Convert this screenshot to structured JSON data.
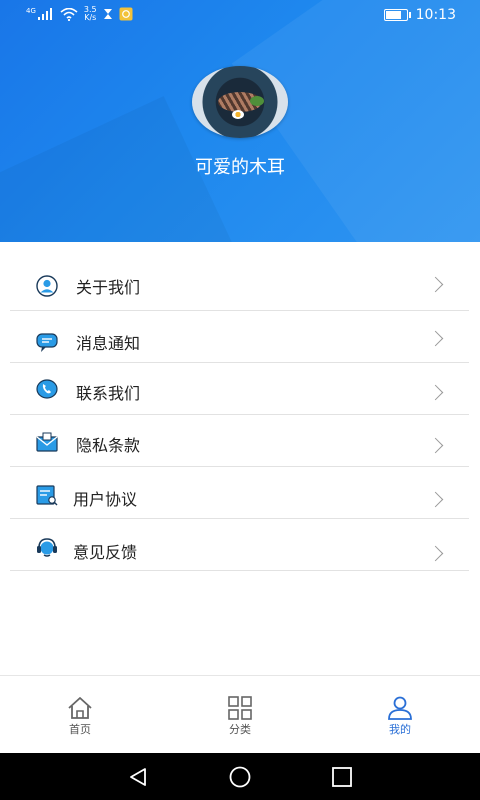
{
  "status_bar": {
    "network_type": "4G",
    "speed_value": "3.5",
    "speed_unit": "K/s",
    "time": "10:13",
    "battery_level": 0.85
  },
  "profile": {
    "username": "可爱的木耳"
  },
  "menu": {
    "items": [
      {
        "label": "关于我们",
        "icon": "user-circle-icon"
      },
      {
        "label": "消息通知",
        "icon": "message-icon"
      },
      {
        "label": "联系我们",
        "icon": "phone-icon"
      },
      {
        "label": "隐私条款",
        "icon": "envelope-icon"
      },
      {
        "label": "用户协议",
        "icon": "document-icon"
      },
      {
        "label": "意见反馈",
        "icon": "headset-icon"
      }
    ]
  },
  "tabs": [
    {
      "label": "首页",
      "icon": "home-icon"
    },
    {
      "label": "分类",
      "icon": "grid-icon"
    },
    {
      "label": "我的",
      "icon": "person-icon",
      "active": true
    }
  ],
  "colors": {
    "header": "#1e88ee",
    "active_tab": "#2a6fd6",
    "icon_blue": "#2a9be6"
  }
}
